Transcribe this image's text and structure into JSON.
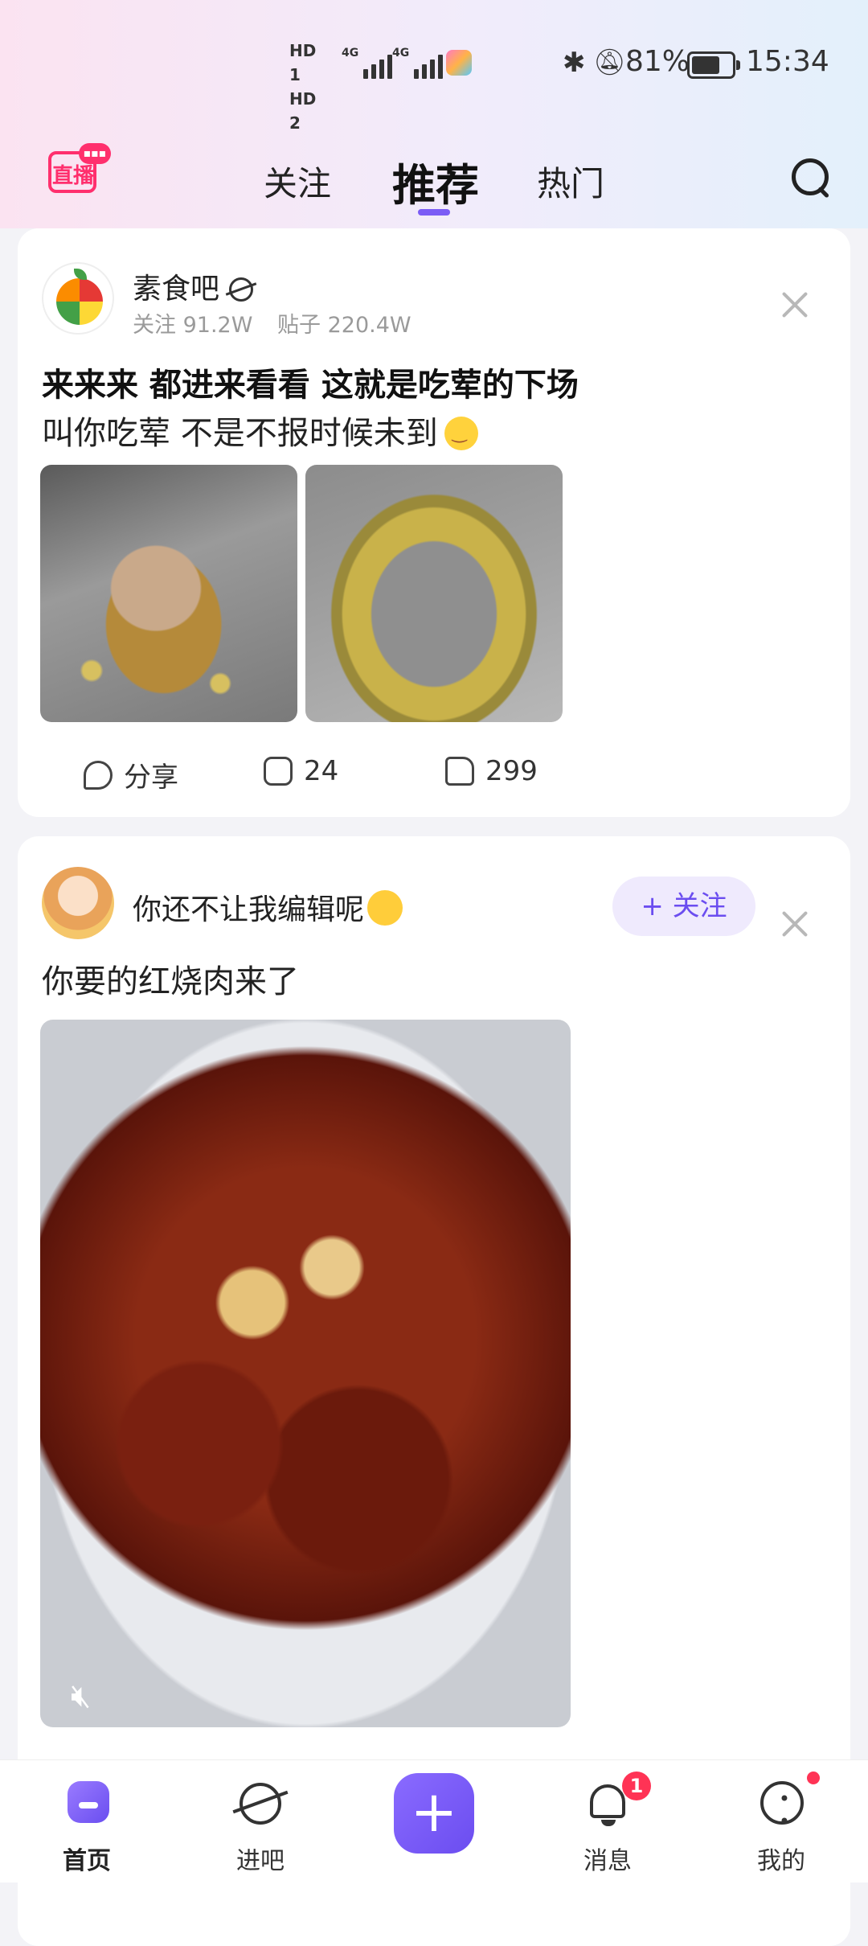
{
  "status_bar": {
    "hd1": "HD 1",
    "hd2": "HD 2",
    "net1": "4G",
    "net2": "4G",
    "battery_percent": "81%",
    "battery_level": 0.81,
    "time": "15:34"
  },
  "header": {
    "live_label": "直播",
    "tabs": [
      {
        "label": "关注"
      },
      {
        "label": "推荐"
      },
      {
        "label": "热门"
      }
    ],
    "active_tab": "推荐"
  },
  "post1": {
    "forum_name": "素食吧",
    "followers": "关注 91.2W",
    "posts": "贴子 220.4W",
    "title": "来来来 都进来看看 这就是吃荤的下场",
    "body": "叫你吃荤 不是不报时候未到",
    "share_label": "分享",
    "comment_count": "24",
    "like_count": "299"
  },
  "post2": {
    "user_name": "你还不让我编辑呢",
    "follow_label": "+ 关注",
    "body": "你要的红烧肉来了"
  },
  "bottom_nav": {
    "items": [
      {
        "label": "首页"
      },
      {
        "label": "进吧"
      },
      {
        "label": "消息"
      },
      {
        "label": "我的"
      }
    ],
    "message_badge": "1"
  },
  "colors": {
    "accent": "#6b4df0",
    "live": "#ff2f6d",
    "badge": "#ff3355"
  }
}
